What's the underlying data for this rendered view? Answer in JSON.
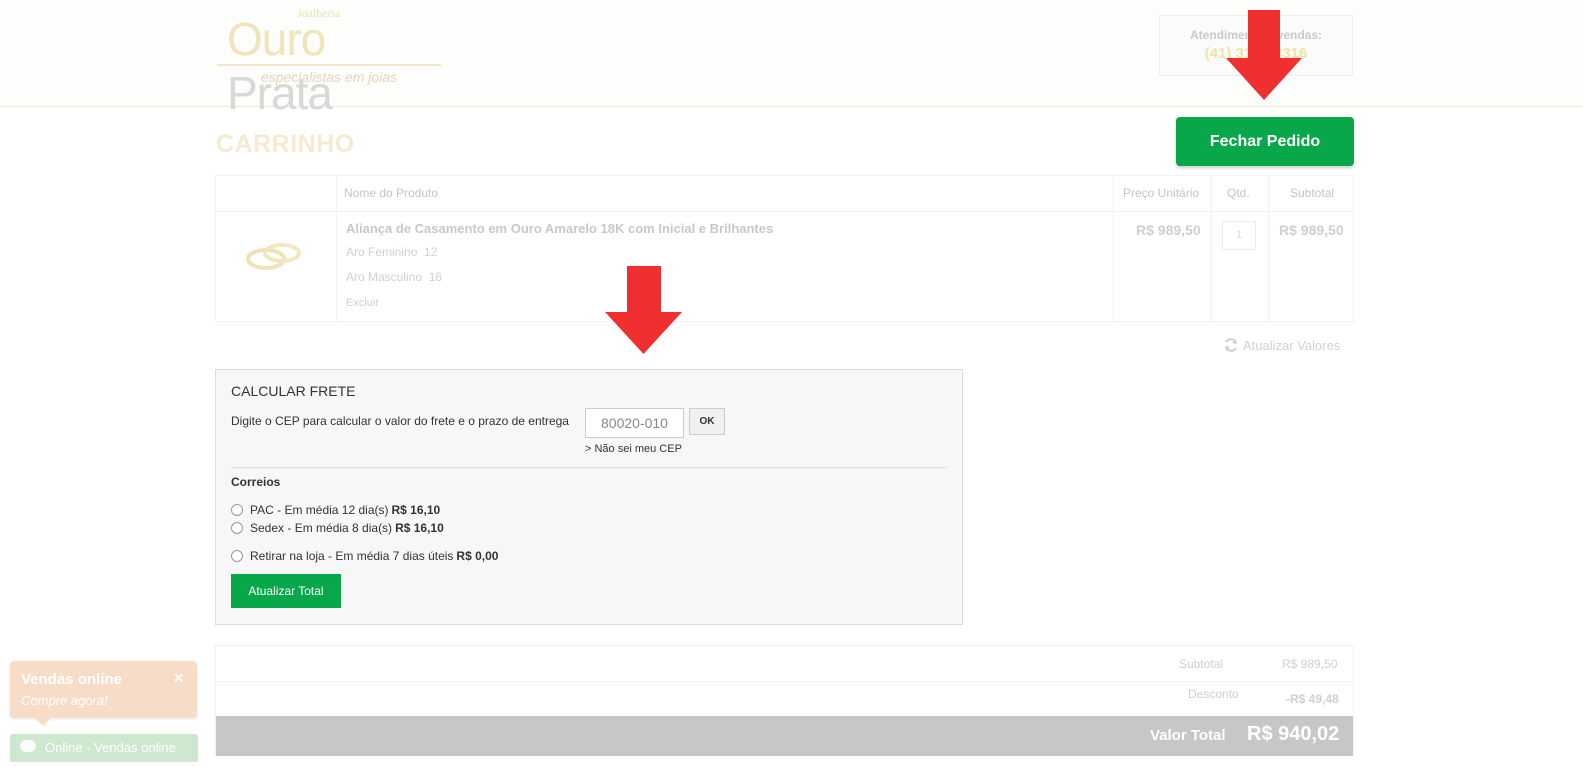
{
  "header": {
    "logo": {
      "small": "Joalheria",
      "big_part1": "Ouro",
      "big_part2": " Prata",
      "tagline": "especialistas em joias"
    },
    "contact": {
      "label": "Atendimento e vendas:",
      "phone": "(41) 3123-4316"
    }
  },
  "cart": {
    "title": "CARRINHO",
    "checkout_button": "Fechar Pedido",
    "columns": [
      "Nome do Produto",
      "Preço Unitário",
      "Qtd.",
      "Subtotal"
    ],
    "item": {
      "name": "Aliança de Casamento em Ouro Amarelo 18K com Inicial e Brilhantes",
      "option1_label": "Aro Feminino",
      "option1_value": "12",
      "option2_label": "Aro Masculino",
      "option2_value": "16",
      "remove": "Excluir",
      "unit_price": "R$ 989,50",
      "quantity": "1",
      "subtotal": "R$ 989,50"
    },
    "refresh_label": "Atualizar Valores"
  },
  "shipping": {
    "title": "CALCULAR FRETE",
    "description": "Digite o CEP para calcular o valor do frete e o prazo de entrega",
    "cep_value": "80020-010",
    "ok_label": "OK",
    "dont_know": "> Não sei meu CEP",
    "carrier": "Correios",
    "options": [
      {
        "label": "PAC - Em média 12 dia(s)",
        "price": "R$ 16,10"
      },
      {
        "label": "Sedex - Em média 8 dia(s)",
        "price": "R$ 16,10"
      },
      {
        "label": "Retirar na loja - Em média 7 dias úteis",
        "price": "R$ 0,00"
      }
    ],
    "update_button": "Atualizar Total"
  },
  "totals": {
    "subtotal_label": "Subtotal",
    "subtotal_value": "R$ 989,50",
    "discount_label": "Desconto",
    "discount_value": "-R$ 49,48",
    "total_label": "Valor Total",
    "total_value": "R$ 940,02"
  },
  "chat": {
    "title": "Vendas online",
    "subtitle": "Compre agora!",
    "close": "×",
    "status": "Online - Vendas online"
  },
  "colors": {
    "accent_green": "#07a74a",
    "arrow_red": "#f03030"
  }
}
